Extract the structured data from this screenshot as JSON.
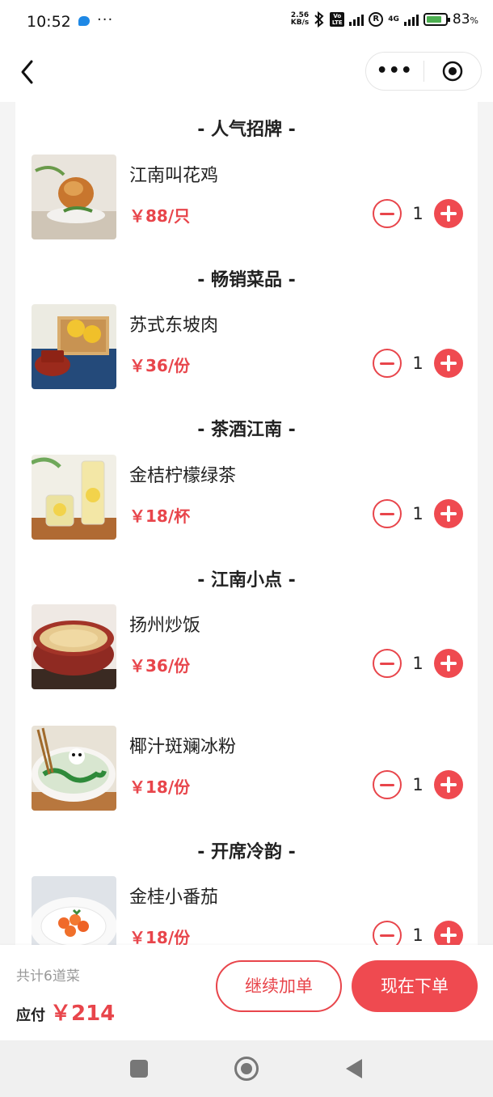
{
  "status_bar": {
    "time": "10:52",
    "speed_value": "2.56",
    "speed_unit": "KB/s",
    "volte": "Vo LTE",
    "network": "4G",
    "battery": "83",
    "battery_unit": "%",
    "battery_level": 0.83
  },
  "sections": [
    {
      "title": "- 人气招牌 -",
      "dishes": [
        {
          "name": "江南叫花鸡",
          "price": "￥88/只",
          "qty": "1"
        }
      ]
    },
    {
      "title": "- 畅销菜品 -",
      "dishes": [
        {
          "name": "苏式东坡肉",
          "price": "￥36/份",
          "qty": "1"
        }
      ]
    },
    {
      "title": "- 茶酒江南 -",
      "dishes": [
        {
          "name": "金桔柠檬绿茶",
          "price": "￥18/杯",
          "qty": "1"
        }
      ]
    },
    {
      "title": "- 江南小点 -",
      "dishes": [
        {
          "name": "扬州炒饭",
          "price": "￥36/份",
          "qty": "1"
        },
        {
          "name": "椰汁斑斓冰粉",
          "price": "￥18/份",
          "qty": "1"
        }
      ]
    },
    {
      "title": "- 开席冷韵 -",
      "dishes": [
        {
          "name": "金桂小番茄",
          "price": "￥18/份",
          "qty": "1"
        }
      ]
    }
  ],
  "footer": {
    "total_count": "共计6道菜",
    "pay_label": "应付",
    "pay_amount": "￥214",
    "continue_label": "继续加单",
    "order_label": "现在下单"
  },
  "colors": {
    "accent": "#ef4a50",
    "price": "#e8454b"
  }
}
